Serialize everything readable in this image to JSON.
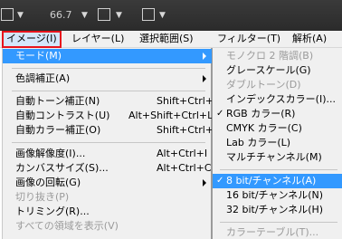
{
  "toolbar": {
    "zoom": "66.7",
    "dropdown_arrow": "▼"
  },
  "menubar": {
    "items": [
      {
        "label": "イメージ(I)"
      },
      {
        "label": "レイヤー(L)"
      },
      {
        "label": "選択範囲(S)"
      },
      {
        "label": "フィルター(T)"
      },
      {
        "label": "解析(A)"
      }
    ]
  },
  "image_menu": {
    "mode": "モード(M)",
    "adjustments": "色調補正(A)",
    "auto_tone": {
      "label": "自動トーン補正(N)",
      "shortcut": "Shift+Ctrl+L"
    },
    "auto_contrast": {
      "label": "自動コントラスト(U)",
      "shortcut": "Alt+Shift+Ctrl+L"
    },
    "auto_color": {
      "label": "自動カラー補正(O)",
      "shortcut": "Shift+Ctrl+B"
    },
    "image_size": {
      "label": "画像解像度(I)...",
      "shortcut": "Alt+Ctrl+I"
    },
    "canvas_size": {
      "label": "カンバスサイズ(S)...",
      "shortcut": "Alt+Ctrl+C"
    },
    "rotation": "画像の回転(G)",
    "crop": "切り抜き(P)",
    "trim": "トリミング(R)...",
    "reveal_all": "すべての領域を表示(V)"
  },
  "mode_menu": {
    "bitmap": "モノクロ 2 階調(B)",
    "grayscale": "グレースケール(G)",
    "duotone": "ダブルトーン(D)",
    "indexed": "インデックスカラー(I)...",
    "rgb": "RGB カラー(R)",
    "cmyk": "CMYK カラー(C)",
    "lab": "Lab カラー(L)",
    "multichannel": "マルチチャンネル(M)",
    "bit8": "8 bit/チャンネル(A)",
    "bit16": "16 bit/チャンネル(N)",
    "bit32": "32 bit/チャンネル(H)",
    "color_table": "カラーテーブル(T)...",
    "check": "✓"
  },
  "colors": {
    "highlight": "#3399ff",
    "active_outline": "#e8141c",
    "menu_bg": "#f0f0f0",
    "toolbar_bg": "#2f2f2f"
  }
}
